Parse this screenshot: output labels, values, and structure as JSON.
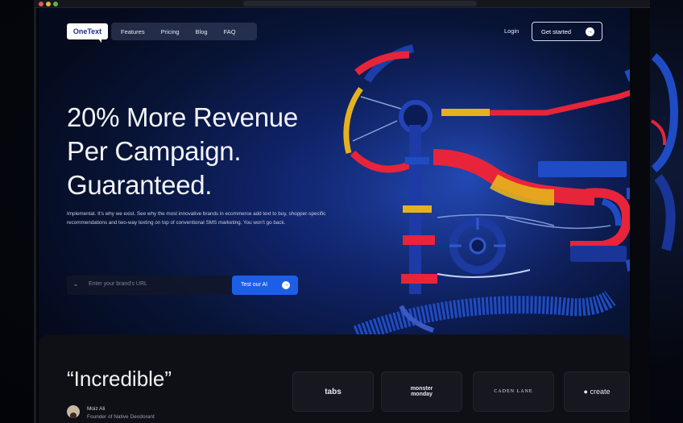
{
  "nav": {
    "logo": "OneText",
    "links": [
      "Features",
      "Pricing",
      "Blog",
      "FAQ"
    ],
    "login": "Login",
    "cta": "Get started"
  },
  "hero": {
    "lines": [
      "20% More Revenue",
      "Per Campaign.",
      "Guaranteed."
    ],
    "subtext": "Implementat. It's why we exist. See why the most innovative brands in ecommerce add text to buy, shopper-specific recommendations and two-way texting on top of conventional SMS marketing. You won't go back.",
    "input_placeholder": "Enter your brand's URL",
    "button": "Test our AI"
  },
  "testimonial": {
    "quote": "“Incredible”",
    "name": "Moiz Ali",
    "role": "Founder of Native Deodorant"
  },
  "brands": [
    "tabs",
    "monster monday",
    "CADEN LANE",
    "create"
  ],
  "colors": {
    "accent": "#1d5ee8",
    "red": "#e8243a",
    "yellow": "#e5b21d",
    "blue": "#1f4cc4"
  }
}
